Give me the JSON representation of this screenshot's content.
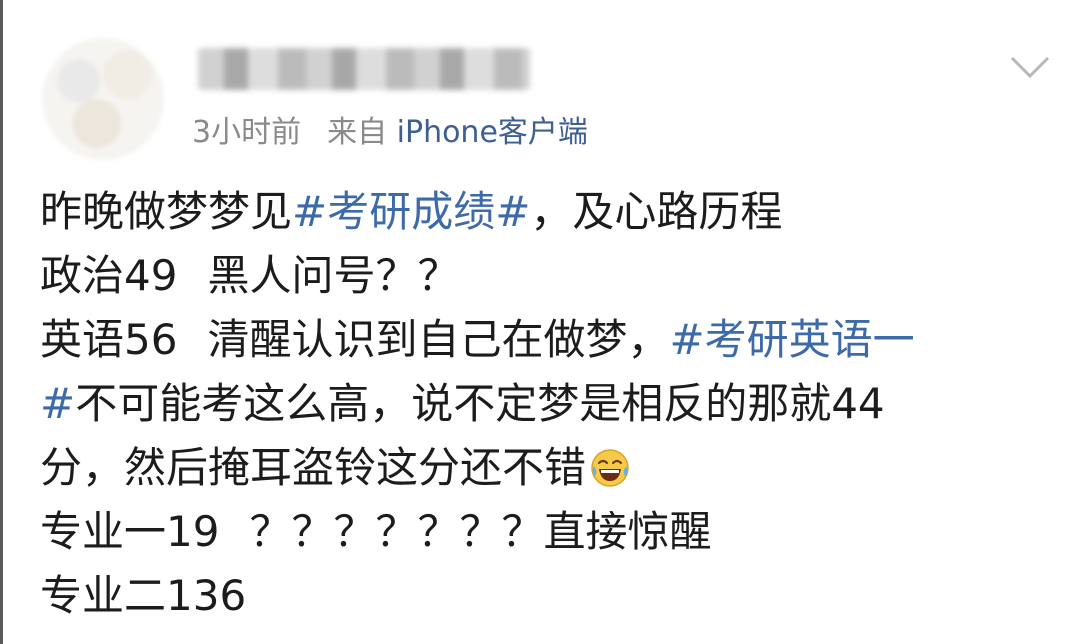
{
  "post": {
    "time": "3小时前",
    "source_prefix": "来自",
    "device": "iPhone客户端",
    "emoji_name": "laugh-cry-emoji",
    "lines": {
      "l1_a": "昨晚做梦梦见",
      "l1_tag": "#考研成绩#",
      "l1_b": "，及心路历程",
      "l2_a": "政治49",
      "l2_b": "黑人问号？？",
      "l3_a": "英语56",
      "l3_b": "清醒认识到自己在做梦，",
      "l3_tag": "#考研英语一",
      "l4_tag": "#",
      "l4_b": "不可能考这么高，说不定梦是相反的那就44",
      "l5_a": "分，然后掩耳盗铃这分还不错",
      "l6_a": "专业一19",
      "l6_b": "？？？？？？？直接惊醒",
      "l7_a": "专业二136"
    }
  },
  "colors": {
    "link": "#3d6aa8",
    "meta": "#8a8a8a",
    "text": "#1c1c1c"
  }
}
